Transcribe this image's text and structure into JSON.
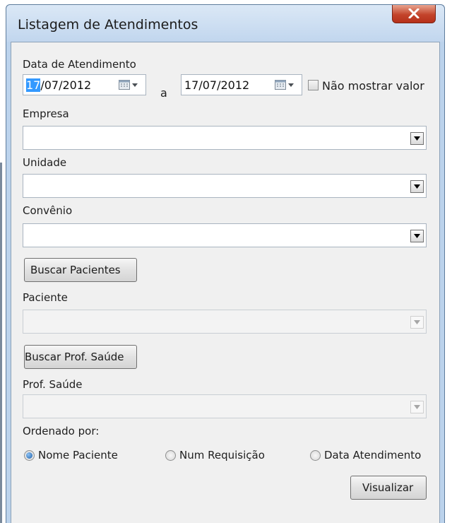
{
  "window": {
    "title": "Listagem de Atendimentos",
    "close_glyph": "X"
  },
  "form": {
    "date_label": "Data de Atendimento",
    "date_from": {
      "selected": "17",
      "rest": "/07/2012"
    },
    "date_separator": "a",
    "date_to": "17/07/2012",
    "hide_value_label": "Não mostrar valor",
    "hide_value_checked": false,
    "empresa_label": "Empresa",
    "empresa_value": "",
    "unidade_label": "Unidade",
    "unidade_value": "",
    "convenio_label": "Convênio",
    "convenio_value": "",
    "buscar_pacientes_label": "Buscar Pacientes",
    "paciente_label": "Paciente",
    "paciente_value": "",
    "buscar_prof_label": "Buscar Prof. Saúde",
    "prof_label": "Prof. Saúde",
    "prof_value": "",
    "ordenado_label": "Ordenado por:",
    "order_options": [
      {
        "label": "Nome Paciente",
        "checked": true
      },
      {
        "label": "Num Requisição",
        "checked": false
      },
      {
        "label": "Data Atendimento",
        "checked": false
      }
    ],
    "visualizar_label": "Visualizar"
  },
  "icons": {
    "calendar": "calendar-dropdown-icon",
    "combo_arrow": "chevron-down-icon",
    "close": "close-icon"
  },
  "colors": {
    "selection": "#3399ff",
    "close_button": "#c3442b",
    "title_bar": "#c1d6ee",
    "client_background": "#f0f0f0"
  }
}
